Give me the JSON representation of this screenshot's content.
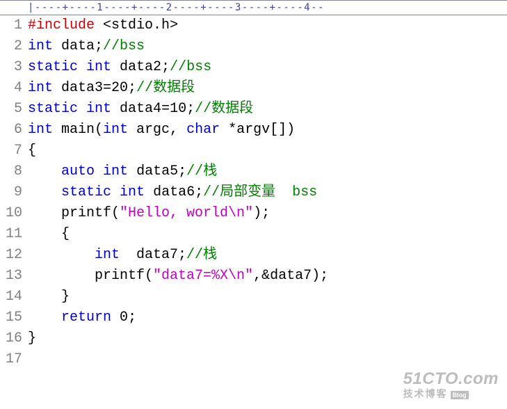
{
  "ruler": "|----+----1----+----2----+----3----+----4--",
  "lines": [
    {
      "n": 1,
      "tokens": [
        [
          "tk-preproc",
          "#include"
        ],
        [
          "tk-plain",
          " <stdio.h>"
        ]
      ]
    },
    {
      "n": 2,
      "tokens": [
        [
          "tk-type",
          "int"
        ],
        [
          "tk-plain",
          " data;"
        ],
        [
          "tk-comment",
          "//bss"
        ]
      ]
    },
    {
      "n": 3,
      "tokens": [
        [
          "tk-keyword",
          "static"
        ],
        [
          "tk-plain",
          " "
        ],
        [
          "tk-type",
          "int"
        ],
        [
          "tk-plain",
          " data2;"
        ],
        [
          "tk-comment",
          "//bss"
        ]
      ]
    },
    {
      "n": 4,
      "tokens": [
        [
          "tk-type",
          "int"
        ],
        [
          "tk-plain",
          " data3="
        ],
        [
          "tk-number",
          "20"
        ],
        [
          "tk-plain",
          ";"
        ],
        [
          "tk-comment",
          "//数据段"
        ]
      ]
    },
    {
      "n": 5,
      "tokens": [
        [
          "tk-keyword",
          "static"
        ],
        [
          "tk-plain",
          " "
        ],
        [
          "tk-type",
          "int"
        ],
        [
          "tk-plain",
          " data4="
        ],
        [
          "tk-number",
          "10"
        ],
        [
          "tk-plain",
          ";"
        ],
        [
          "tk-comment",
          "//数据段"
        ]
      ]
    },
    {
      "n": 6,
      "tokens": [
        [
          "tk-type",
          "int"
        ],
        [
          "tk-plain",
          " main("
        ],
        [
          "tk-type",
          "int"
        ],
        [
          "tk-plain",
          " argc, "
        ],
        [
          "tk-type",
          "char"
        ],
        [
          "tk-plain",
          " *argv[])"
        ]
      ]
    },
    {
      "n": 7,
      "tokens": [
        [
          "tk-plain",
          "{"
        ]
      ]
    },
    {
      "n": 8,
      "tokens": [
        [
          "tk-plain",
          "    "
        ],
        [
          "tk-keyword",
          "auto"
        ],
        [
          "tk-plain",
          " "
        ],
        [
          "tk-type",
          "int"
        ],
        [
          "tk-plain",
          " data5;"
        ],
        [
          "tk-comment",
          "//栈"
        ]
      ]
    },
    {
      "n": 9,
      "tokens": [
        [
          "tk-plain",
          "    "
        ],
        [
          "tk-keyword",
          "static"
        ],
        [
          "tk-plain",
          " "
        ],
        [
          "tk-type",
          "int"
        ],
        [
          "tk-plain",
          " data6;"
        ],
        [
          "tk-comment",
          "//局部变量  bss"
        ]
      ]
    },
    {
      "n": 10,
      "tokens": [
        [
          "tk-plain",
          "    printf("
        ],
        [
          "tk-string",
          "\"Hello, world\\n\""
        ],
        [
          "tk-plain",
          ");"
        ]
      ]
    },
    {
      "n": 11,
      "tokens": [
        [
          "tk-plain",
          "    {"
        ]
      ]
    },
    {
      "n": 12,
      "tokens": [
        [
          "tk-plain",
          "        "
        ],
        [
          "tk-type",
          "int"
        ],
        [
          "tk-plain",
          "  data7;"
        ],
        [
          "tk-comment",
          "//栈"
        ]
      ]
    },
    {
      "n": 13,
      "tokens": [
        [
          "tk-plain",
          "        printf("
        ],
        [
          "tk-string",
          "\"data7=%X\\n\""
        ],
        [
          "tk-plain",
          ",&data7);"
        ]
      ]
    },
    {
      "n": 14,
      "tokens": [
        [
          "tk-plain",
          "    }"
        ]
      ]
    },
    {
      "n": 15,
      "tokens": [
        [
          "tk-plain",
          "    "
        ],
        [
          "tk-keyword",
          "return"
        ],
        [
          "tk-plain",
          " "
        ],
        [
          "tk-number",
          "0"
        ],
        [
          "tk-plain",
          ";"
        ]
      ]
    },
    {
      "n": 16,
      "tokens": [
        [
          "tk-plain",
          "}"
        ]
      ]
    },
    {
      "n": 17,
      "tokens": [
        [
          "tk-plain",
          ""
        ]
      ]
    }
  ],
  "watermark": {
    "top": "51CTO.com",
    "bottom": "技术博客",
    "blog": "Blog"
  }
}
